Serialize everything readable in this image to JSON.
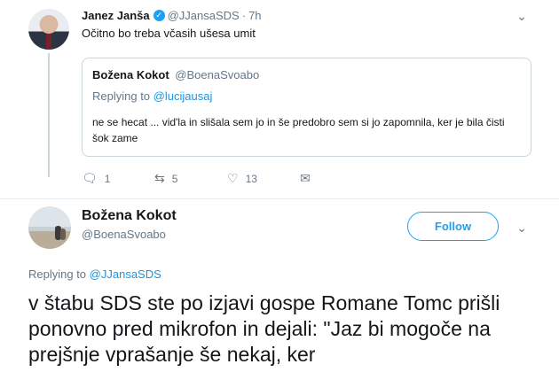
{
  "parent": {
    "name": "Janez Janša",
    "handle": "@JJansaSDS",
    "dot": "·",
    "time": "7h",
    "text": "Očitno bo treba včasih ušesa umit",
    "quote": {
      "name": "Božena Kokot",
      "handle": "@BoenaSvoabo",
      "replying_prefix": "Replying to",
      "replying_handle": "@lucijausaj",
      "text": "ne se hecat ... vid'la in slišala sem jo in še predobro sem si jo zapomnila, ker je bila čisti šok zame"
    },
    "actions": {
      "reply_count": "1",
      "retweet_count": "5",
      "like_count": "13"
    }
  },
  "main": {
    "name": "Božena Kokot",
    "handle": "@BoenaSvoabo",
    "follow_label": "Follow",
    "replying_prefix": "Replying to",
    "replying_handle": "@JJansaSDS",
    "text": "v štabu SDS ste po izjavi gospe Romane Tomc prišli ponovno pred mikrofon in dejali:  \"Jaz bi mogoče na prejšnje vprašanje še nekaj, ker"
  },
  "icons": {
    "reply": "reply-icon",
    "retweet": "retweet-icon",
    "like": "heart-icon",
    "dm": "mail-icon",
    "verified": "verified-badge-icon",
    "more": "chevron-down-icon"
  },
  "colors": {
    "accent": "#1da1f2",
    "link": "#1b95e0",
    "muted": "#657786",
    "border": "#ccd6dd"
  }
}
